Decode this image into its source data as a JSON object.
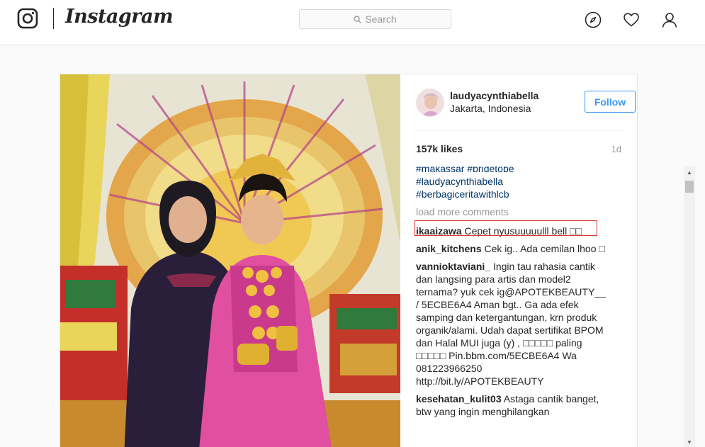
{
  "header": {
    "brand": "Instagram",
    "search_placeholder": "Search",
    "icons": [
      "instagram-logo-icon",
      "compass-icon",
      "heart-icon",
      "profile-icon"
    ]
  },
  "post": {
    "username": "laudyacynthiabella",
    "location": "Jakarta, Indonesia",
    "follow_label": "Follow",
    "likes": "157k likes",
    "age": "1d",
    "tags": [
      "#makassar #bridetobe",
      "#laudyacynthiabella",
      "#berbagiceritawithlcb"
    ],
    "load_more": "load more comments",
    "comments": [
      {
        "user": "ikaaizawa",
        "text": "Cepet nyusuuuuulll bell □□"
      },
      {
        "user": "anik_kitchens",
        "text": "Cek ig.. Ada cemilan lhoo □"
      },
      {
        "user": "vannioktaviani_",
        "text": "Ingin tau rahasia cantik dan langsing para artis dan model2 ternama? yuk cek ig@APOTEKBEAUTY__ / 5ECBE6A4 Aman bgt.. Ga ada efek samping dan ketergantungan, krn produk organik/alami. Udah dapat sertifikat BPOM dan Halal MUI juga (y) , □□□□□ paling □□□□□ Pin.bbm.com/5ECBE6A4 Wa 081223966250 http://bit.ly/APOTEKBEAUTY"
      },
      {
        "user": "kesehatan_kulit03",
        "text": "Astaga cantik banget, btw yang ingin menghilangkan"
      }
    ]
  },
  "colors": {
    "accent": "#3897f0",
    "hashtag": "#003569",
    "muted": "#999999",
    "highlight_border": "#dd3333"
  }
}
